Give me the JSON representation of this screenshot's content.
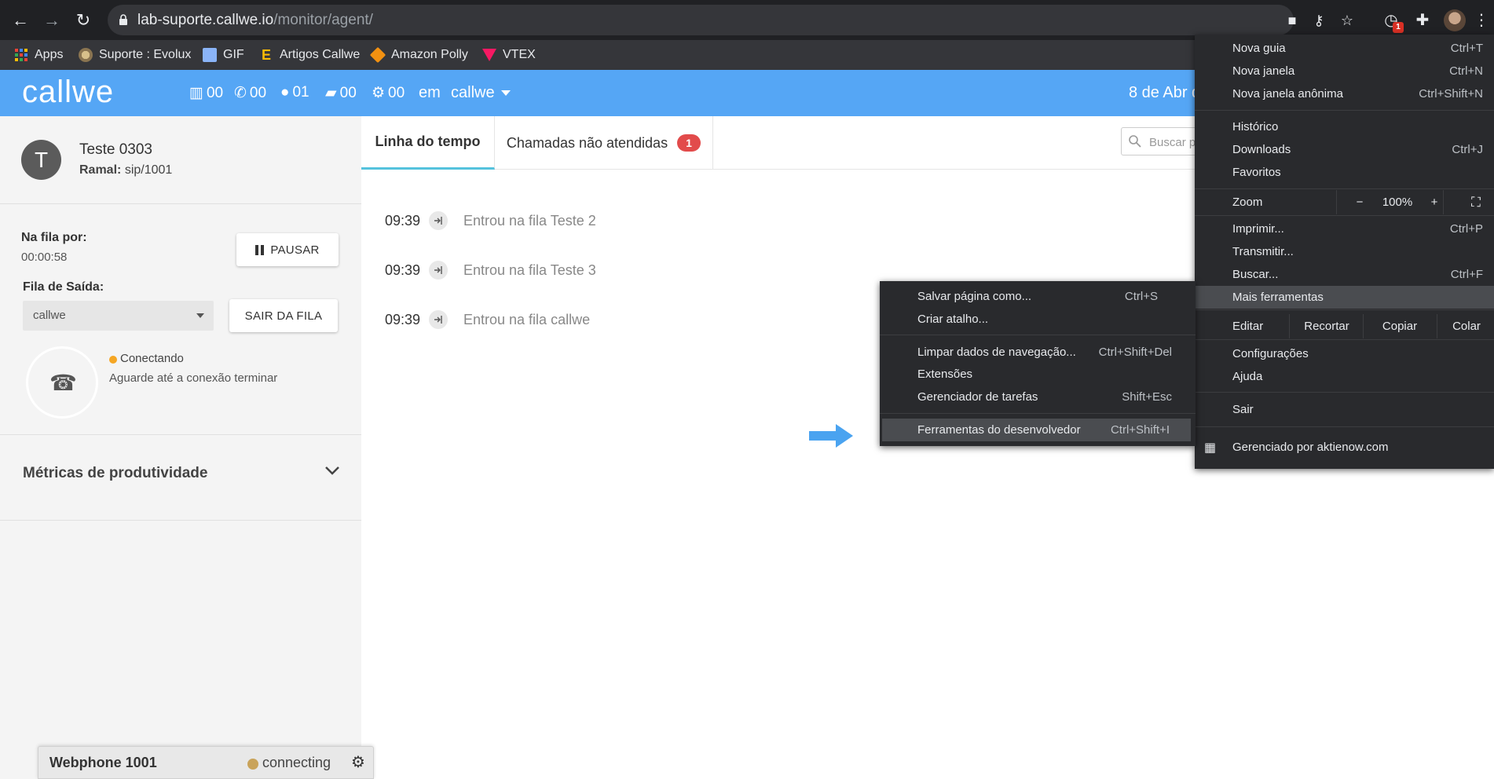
{
  "browser": {
    "url_host": "lab-suporte.callwe.io",
    "url_path": "/monitor/agent/",
    "badge_count": "1",
    "bookmarks": [
      {
        "label": "Apps",
        "icon": "apps-grid-icon"
      },
      {
        "label": "Suporte : Evolux",
        "icon": "evolux-icon"
      },
      {
        "label": "GIF",
        "icon": "gif-icon"
      },
      {
        "label": "Artigos Callwe",
        "icon": "callwe-e-icon"
      },
      {
        "label": "Amazon Polly",
        "icon": "amazon-box-icon"
      },
      {
        "label": "VTEX",
        "icon": "vtex-icon"
      }
    ]
  },
  "header": {
    "logo": "callwe",
    "stats": [
      {
        "icon": "queue-icon",
        "value": "00"
      },
      {
        "icon": "phone-icon",
        "value": "00"
      },
      {
        "icon": "user-icon",
        "value": "01"
      },
      {
        "icon": "pause-cup-icon",
        "value": "00"
      },
      {
        "icon": "gear-icon",
        "value": "00"
      }
    ],
    "em": "em",
    "queue": "callwe",
    "date": "8 de Abr d"
  },
  "agent": {
    "initial": "T",
    "name": "Teste 0303",
    "ramal_label": "Ramal:",
    "ramal_value": "sip/1001",
    "queue_time_label": "Na fila por:",
    "queue_time": "00:00:58",
    "pause_label": "PAUSAR",
    "exit_queue_label": "Fila de Saída:",
    "exit_queue_value": "callwe",
    "leave_button": "SAIR DA FILA",
    "conn_status": "Conectando",
    "conn_msg": "Aguarde até a conexão terminar",
    "metrics_title": "Métricas de produtividade"
  },
  "tabs": {
    "timeline": "Linha do tempo",
    "missed": "Chamadas não atendidas",
    "missed_count": "1",
    "search_placeholder": "Buscar p"
  },
  "timeline": [
    {
      "time": "09:39",
      "text": "Entrou na fila Teste 2"
    },
    {
      "time": "09:39",
      "text": "Entrou na fila Teste 3"
    },
    {
      "time": "09:39",
      "text": "Entrou na fila callwe"
    }
  ],
  "webphone": {
    "title": "Webphone 1001",
    "status": "connecting"
  },
  "chrome_menu": {
    "new_tab": "Nova guia",
    "new_tab_key": "Ctrl+T",
    "new_window": "Nova janela",
    "new_window_key": "Ctrl+N",
    "incognito": "Nova janela anônima",
    "incognito_key": "Ctrl+Shift+N",
    "history": "Histórico",
    "downloads": "Downloads",
    "downloads_key": "Ctrl+J",
    "favorites": "Favoritos",
    "zoom": "Zoom",
    "zoom_minus": "−",
    "zoom_value": "100%",
    "zoom_plus": "+",
    "print": "Imprimir...",
    "print_key": "Ctrl+P",
    "cast": "Transmitir...",
    "find": "Buscar...",
    "find_key": "Ctrl+F",
    "more_tools": "Mais ferramentas",
    "edit": "Editar",
    "cut": "Recortar",
    "copy": "Copiar",
    "paste": "Colar",
    "settings": "Configurações",
    "help": "Ajuda",
    "exit": "Sair",
    "managed": "Gerenciado por aktienow.com"
  },
  "submenu": {
    "save_page": "Salvar página como...",
    "save_page_key": "Ctrl+S",
    "shortcut": "Criar atalho...",
    "clear_data": "Limpar dados de navegação...",
    "clear_data_key": "Ctrl+Shift+Del",
    "extensions": "Extensões",
    "task_manager": "Gerenciador de tarefas",
    "task_manager_key": "Shift+Esc",
    "dev_tools": "Ferramentas do desenvolvedor",
    "dev_tools_key": "Ctrl+Shift+I"
  }
}
